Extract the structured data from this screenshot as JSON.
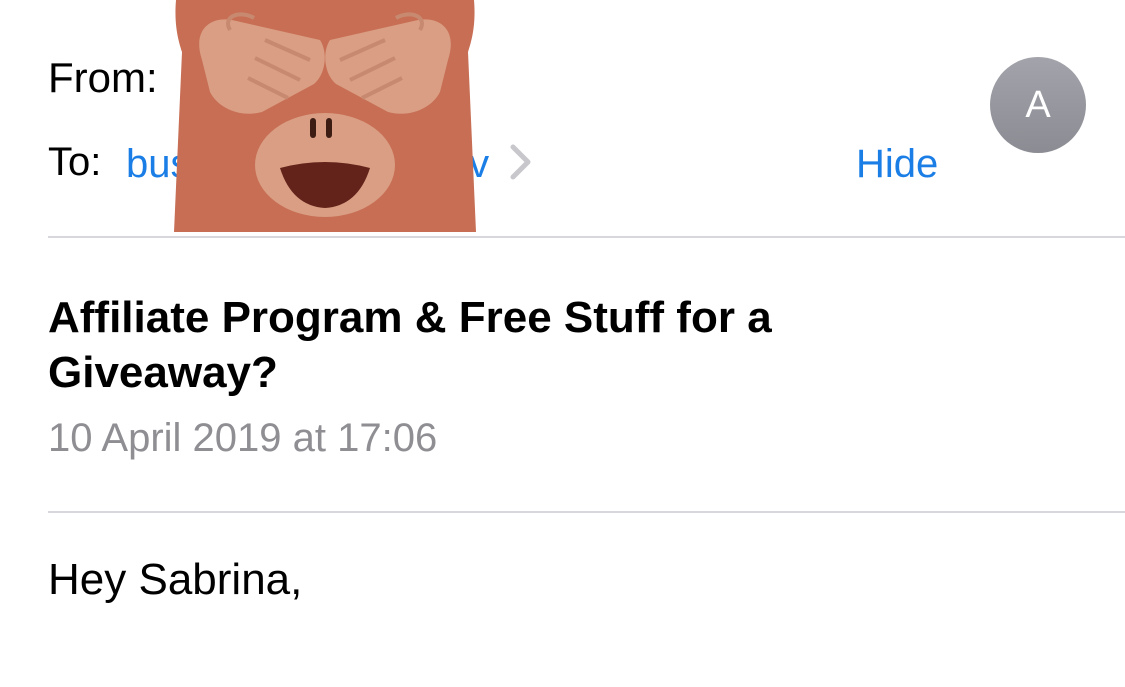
{
  "header": {
    "from_label": "From:",
    "to_label": "To:",
    "to_value_start": "bus",
    "to_value_end": "tv",
    "hide_label": "Hide",
    "avatar_initial": "A"
  },
  "message": {
    "subject": "Affiliate Program & Free Stuff for a Giveaway?",
    "date": "10 April 2019 at 17:06",
    "greeting": "Hey Sabrina,"
  },
  "icons": {
    "redaction": "see-no-evil-monkey-icon",
    "recipient_chevron": "chevron-right-icon"
  },
  "colors": {
    "link": "#1a7ee6",
    "date": "#8e8e93",
    "monkey_fur": "#c76e54",
    "monkey_face": "#d99e83",
    "monkey_mouth": "#63231a"
  }
}
